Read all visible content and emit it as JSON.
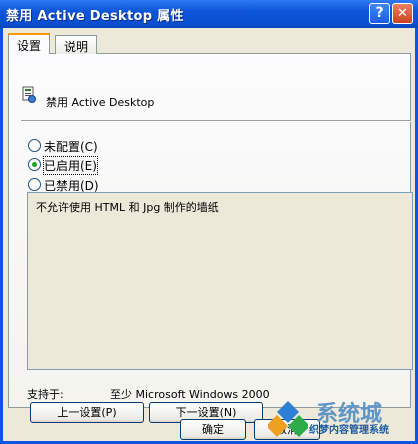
{
  "window": {
    "title": "禁用 Active Desktop 属性"
  },
  "tabs": [
    {
      "label": "设置"
    },
    {
      "label": "说明"
    }
  ],
  "policy": {
    "name": "禁用 Active Desktop"
  },
  "options": [
    {
      "label": "未配置(C)",
      "checked": false
    },
    {
      "label": "已启用(E)",
      "checked": true
    },
    {
      "label": "已禁用(D)",
      "checked": false
    }
  ],
  "explain_text": "不允许使用 HTML 和 Jpg 制作的墙纸",
  "support": {
    "label": "支持于:",
    "value": "至少 Microsoft Windows 2000"
  },
  "buttons": {
    "prev": "上一设置(P)",
    "next": "下一设置(N)",
    "ok": "确定",
    "cancel": "取消"
  },
  "watermark": {
    "big": "系统城",
    "small": "织梦内容管理系统"
  },
  "colors": {
    "titlebar": "#0b55d8",
    "dialog_bg": "#ece9d8",
    "tab_highlight": "#ff9a00",
    "radio_dot": "#21a121"
  }
}
